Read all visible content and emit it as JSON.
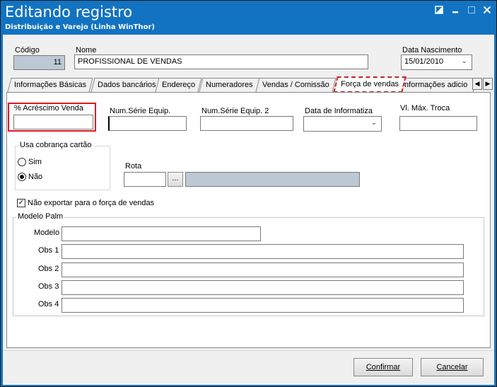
{
  "window": {
    "title": "Editando registro",
    "subtitle": "Distribuição e Varejo (Linha WinThor)",
    "controls": [
      "restore-icon",
      "minimize-icon",
      "maximize-icon",
      "close-icon"
    ]
  },
  "header": {
    "codigo_label": "Código",
    "codigo_value": "11",
    "nome_label": "Nome",
    "nome_value": "PROFISSIONAL DE VENDAS",
    "nascimento_label": "Data Nascimento",
    "nascimento_value": "15/01/2010"
  },
  "tabs": [
    {
      "label": "Informações Básicas"
    },
    {
      "label": "Dados bancários"
    },
    {
      "label": "Endereço"
    },
    {
      "label": "Numeradores"
    },
    {
      "label": "Vendas  / Comissão"
    },
    {
      "label": "Força de vendas",
      "active": true
    },
    {
      "label": "Informações adicio"
    }
  ],
  "forca": {
    "acrescimo_label": "% Acréscimo Venda",
    "acrescimo_value": "",
    "serie1_label": "Num.Série Equip.",
    "serie1_value": "",
    "serie2_label": "Num.Série Equip. 2",
    "serie2_value": "",
    "informatiza_label": "Data de Informatiza",
    "informatiza_value": "",
    "troca_label": "Vl. Máx. Troca",
    "troca_value": "",
    "cobranca_group": "Usa cobrança cartão",
    "sim_label": "Sim",
    "nao_label": "Não",
    "cobranca_selected": "Não",
    "rota_label": "Rota",
    "rota_value": "",
    "rota_button": "...",
    "exportar_label": "Não exportar para o força de vendas",
    "exportar_checked": true,
    "palm_group": "Modelo Palm",
    "modelo_label": "Modelo",
    "obs1_label": "Obs 1",
    "obs2_label": "Obs 2",
    "obs3_label": "Obs 3",
    "obs4_label": "Obs 4"
  },
  "footer": {
    "confirmar_label": "Confirmar",
    "cancelar_label": "Cancelar"
  },
  "colors": {
    "titlebar": "#1273c2",
    "highlight": "#e0161f",
    "gray_field": "#bcc8d4"
  }
}
